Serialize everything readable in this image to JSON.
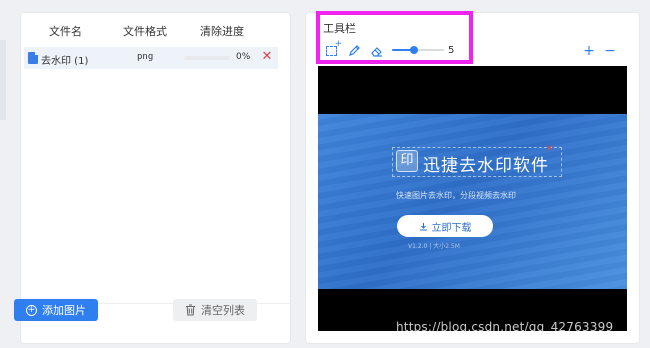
{
  "file_list": {
    "columns": [
      "文件名",
      "文件格式",
      "清除进度"
    ],
    "rows": [
      {
        "name": "去水印 (1)",
        "format": "png",
        "progress": 0,
        "progress_text": "0%"
      }
    ]
  },
  "buttons": {
    "add_image": "添加图片",
    "clear_list": "清空列表"
  },
  "toolbar": {
    "title": "工具栏",
    "tools": [
      "rect-select-icon",
      "pen-icon",
      "eraser-icon"
    ],
    "brush_size": 5,
    "brush_max": 10,
    "brush_size_text": "5",
    "zoom_in": "+",
    "zoom_out": "−"
  },
  "preview": {
    "app_name": "迅捷去水印软件",
    "logo_char": "印",
    "slogan": "快速图片去水印，分段视频去水印",
    "download_label": "立即下载",
    "version_text": "V1.2.0 | 大小2.5M"
  },
  "watermark": "https://blog.csdn.net/qq_42763399",
  "colors": {
    "accent": "#2f7ff0",
    "delete": "#e0454b",
    "highlight": "#f023f0",
    "banner": "#3a7fd6"
  }
}
